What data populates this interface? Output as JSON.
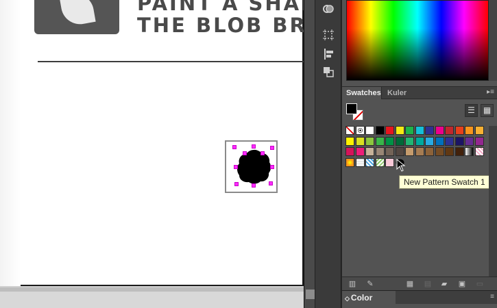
{
  "artboard": {
    "title_line1": "PAINT A SHAPE",
    "title_line2": "THE BLOB BRU",
    "logo": "leaf-logo"
  },
  "toolbar": {
    "icons": [
      "color-icon",
      "artboards-icon",
      "align-icon",
      "pathfinder-icon"
    ]
  },
  "swatches_panel": {
    "tabs": [
      {
        "label": "Swatches",
        "active": true
      },
      {
        "label": "Kuler",
        "active": false
      }
    ],
    "fill_color": "#000000",
    "stroke_color": "none",
    "view_modes": [
      "list-view-icon",
      "grid-view-icon"
    ],
    "swatch_rows": [
      [
        "none",
        "registration",
        "#ffffff",
        "#000000",
        "#e6161f",
        "#f5ea14",
        "#1fb24a",
        "#15bfd8",
        "#2e3192",
        "#ec008c",
        "#c1272d",
        "#e6401c",
        "#f7941d",
        "#f8b133"
      ],
      [
        "#fff200",
        "#d9e021",
        "#8cc63f",
        "#39b54a",
        "#009245",
        "#006837",
        "#22b573",
        "#00a99d",
        "#29abe2",
        "#0071bc",
        "#2e3192",
        "#1b1464",
        "#662d91",
        "#93278f"
      ],
      [
        "#d4145a",
        "#ed1e79",
        "#c7b299",
        "#998675",
        "#736357",
        "#534741",
        "#c69c6d",
        "#a67c52",
        "#8c6239",
        "#754c24",
        "#603813",
        "#42210b",
        "gradient-bw",
        "pattern-pink"
      ],
      [
        "gradient-orange",
        "pattern-grid",
        "pattern-blue",
        "pattern-green",
        "#f9c9d8",
        "new-pattern-blob"
      ]
    ],
    "tooltip": "New Pattern Swatch 1",
    "bottom_icons": [
      "swatch-libraries-icon",
      "place-swatches-icon",
      "show-kinds-icon",
      "swatch-options-icon",
      "new-color-group-icon",
      "new-swatch-icon",
      "delete-swatch-icon"
    ]
  },
  "color_guide": {
    "label": "Color Guide"
  }
}
